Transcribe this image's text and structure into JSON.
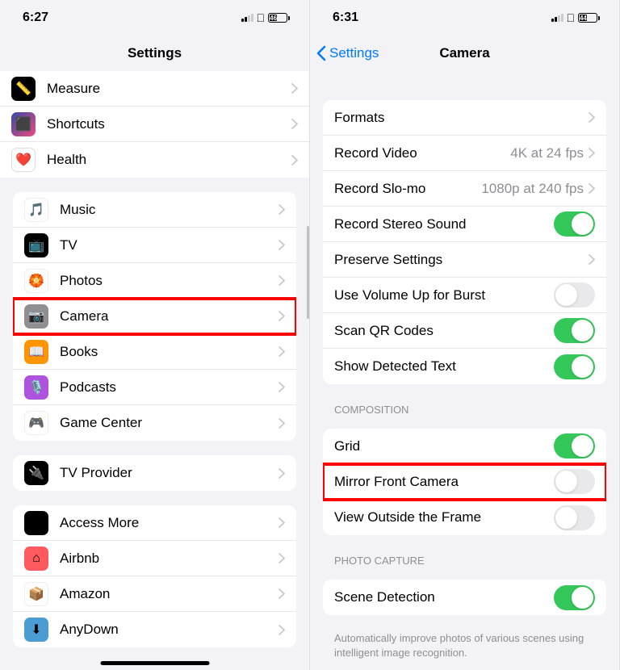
{
  "left": {
    "status": {
      "time": "6:27",
      "battery_pct": "46"
    },
    "title": "Settings",
    "groups": [
      {
        "rows": [
          {
            "id": "measure",
            "label": "Measure",
            "icon": "📏",
            "iconClass": "ic-measure"
          },
          {
            "id": "shortcuts",
            "label": "Shortcuts",
            "icon": "⬛",
            "iconClass": "ic-shortcuts"
          },
          {
            "id": "health",
            "label": "Health",
            "icon": "❤️",
            "iconClass": "ic-health"
          }
        ]
      },
      {
        "rows": [
          {
            "id": "music",
            "label": "Music",
            "icon": "🎵",
            "iconClass": "ic-music"
          },
          {
            "id": "tv",
            "label": "TV",
            "icon": "📺",
            "iconClass": "ic-tv"
          },
          {
            "id": "photos",
            "label": "Photos",
            "icon": "🏵️",
            "iconClass": "ic-photos"
          },
          {
            "id": "camera",
            "label": "Camera",
            "icon": "📷",
            "iconClass": "ic-camera",
            "highlight": true
          },
          {
            "id": "books",
            "label": "Books",
            "icon": "📖",
            "iconClass": "ic-books"
          },
          {
            "id": "podcasts",
            "label": "Podcasts",
            "icon": "🎙️",
            "iconClass": "ic-podcasts"
          },
          {
            "id": "gamecenter",
            "label": "Game Center",
            "icon": "🎮",
            "iconClass": "ic-gamecenter"
          }
        ]
      },
      {
        "rows": [
          {
            "id": "tvprovider",
            "label": "TV Provider",
            "icon": "🔌",
            "iconClass": "ic-tvprovider"
          }
        ]
      },
      {
        "rows": [
          {
            "id": "accessmore",
            "label": "Access More",
            "icon": "◈",
            "iconClass": "ic-access"
          },
          {
            "id": "airbnb",
            "label": "Airbnb",
            "icon": "⌂",
            "iconClass": "ic-airbnb"
          },
          {
            "id": "amazon",
            "label": "Amazon",
            "icon": "📦",
            "iconClass": "ic-amazon"
          },
          {
            "id": "anydown",
            "label": "AnyDown",
            "icon": "⬇",
            "iconClass": "ic-anydown"
          }
        ]
      }
    ]
  },
  "right": {
    "status": {
      "time": "6:31",
      "battery_pct": "44"
    },
    "back": "Settings",
    "title": "Camera",
    "sections": [
      {
        "rows": [
          {
            "id": "formats",
            "label": "Formats",
            "type": "link"
          },
          {
            "id": "record-video",
            "label": "Record Video",
            "type": "link",
            "detail": "4K at 24 fps"
          },
          {
            "id": "record-slomo",
            "label": "Record Slo-mo",
            "type": "link",
            "detail": "1080p at 240 fps"
          },
          {
            "id": "stereo-sound",
            "label": "Record Stereo Sound",
            "type": "toggle",
            "on": true
          },
          {
            "id": "preserve-settings",
            "label": "Preserve Settings",
            "type": "link"
          },
          {
            "id": "volume-burst",
            "label": "Use Volume Up for Burst",
            "type": "toggle",
            "on": false
          },
          {
            "id": "scan-qr",
            "label": "Scan QR Codes",
            "type": "toggle",
            "on": true
          },
          {
            "id": "detected-text",
            "label": "Show Detected Text",
            "type": "toggle",
            "on": true
          }
        ]
      },
      {
        "header": "COMPOSITION",
        "rows": [
          {
            "id": "grid",
            "label": "Grid",
            "type": "toggle",
            "on": true
          },
          {
            "id": "mirror-front",
            "label": "Mirror Front Camera",
            "type": "toggle",
            "on": false,
            "highlight": true
          },
          {
            "id": "view-outside",
            "label": "View Outside the Frame",
            "type": "toggle",
            "on": false
          }
        ]
      },
      {
        "header": "PHOTO CAPTURE",
        "rows": [
          {
            "id": "scene-detection",
            "label": "Scene Detection",
            "type": "toggle",
            "on": true
          }
        ],
        "footer": "Automatically improve photos of various scenes using intelligent image recognition."
      }
    ]
  }
}
